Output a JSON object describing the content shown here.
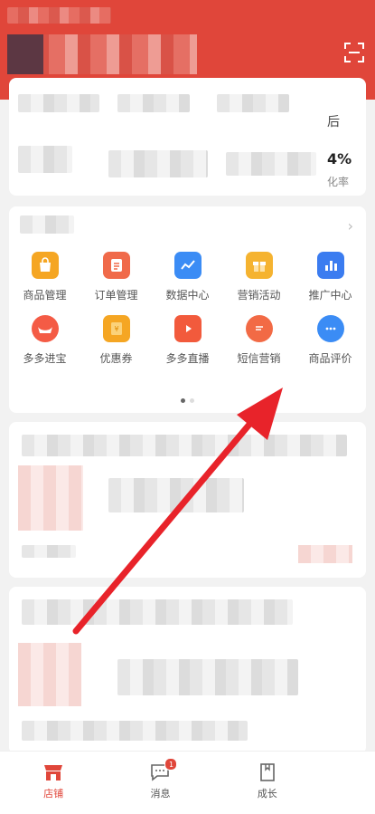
{
  "header": {
    "scan_icon": "scan-icon",
    "color": "#e0463a"
  },
  "stats": {
    "right_top_suffix": "后",
    "right_value_suffix": "4%",
    "right_bottom_suffix": "化率"
  },
  "tools": {
    "more_icon": "chevron-right-icon",
    "items": [
      {
        "label": "商品管理",
        "icon": "shopping-bag-icon",
        "color": "#f5a623"
      },
      {
        "label": "订单管理",
        "icon": "clipboard-icon",
        "color": "#f06a4a"
      },
      {
        "label": "数据中心",
        "icon": "chart-icon",
        "color": "#3b8cf5"
      },
      {
        "label": "营销活动",
        "icon": "gift-box-icon",
        "color": "#f5b330"
      },
      {
        "label": "推广中心",
        "icon": "bar-chart-icon",
        "color": "#3b7cf0"
      },
      {
        "label": "多多进宝",
        "icon": "ingot-icon",
        "color": "#f45b45"
      },
      {
        "label": "优惠券",
        "icon": "coupon-icon",
        "color": "#f5a623"
      },
      {
        "label": "多多直播",
        "icon": "live-video-icon",
        "color": "#f25a3c"
      },
      {
        "label": "短信营销",
        "icon": "message-icon",
        "color": "#f26a45"
      },
      {
        "label": "商品评价",
        "icon": "comment-icon",
        "color": "#3b8cf5"
      }
    ],
    "page_dots": 2,
    "active_page": 1
  },
  "tabbar": {
    "tabs": [
      {
        "label": "店铺",
        "icon": "shop-icon",
        "active": true
      },
      {
        "label": "消息",
        "icon": "chat-icon",
        "active": false,
        "badge": "1"
      },
      {
        "label": "成长",
        "icon": "growth-icon",
        "active": false
      }
    ]
  },
  "annotation": {
    "arrow_color": "#e8232a"
  }
}
